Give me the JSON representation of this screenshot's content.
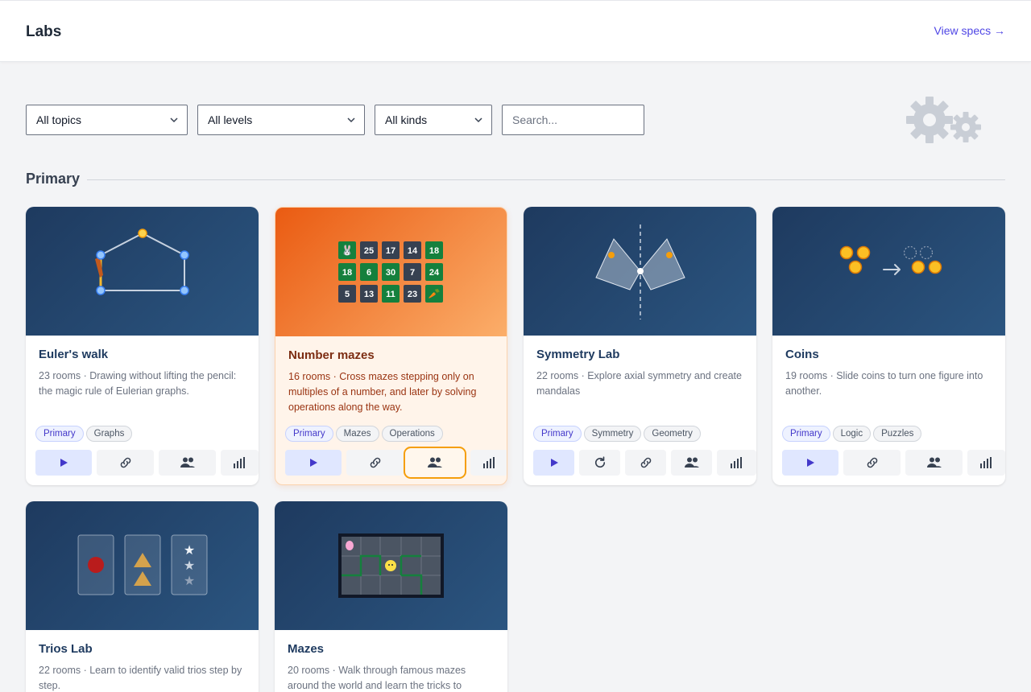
{
  "header": {
    "title": "Labs",
    "specs_link": "View specs →"
  },
  "filters": {
    "topic": "All topics",
    "level": "All levels",
    "kind": "All kinds",
    "search_placeholder": "Search..."
  },
  "section": {
    "title": "Primary"
  },
  "colors": {
    "accent": "#4f46e5",
    "card_thumb": "#1e3a5f",
    "active_card": "#ea5b12",
    "focus_ring": "#f59e0b"
  },
  "cards": [
    {
      "title": "Euler's walk",
      "desc": "23 rooms · Drawing without lifting the pencil: the magic rule of Eulerian graphs.",
      "tags": [
        "Primary",
        "Graphs"
      ],
      "icons": [
        "play-icon",
        "link-icon",
        "users-icon",
        "stats-icon"
      ]
    },
    {
      "title": "Number mazes",
      "desc": "16 rooms · Cross mazes stepping only on multiples of a number, and later by solving operations along the way.",
      "tags": [
        "Primary",
        "Mazes",
        "Operations"
      ],
      "grid": [
        [
          "🐰",
          "25",
          "17",
          "14",
          "18"
        ],
        [
          "18",
          "6",
          "30",
          "7",
          "24"
        ],
        [
          "5",
          "13",
          "11",
          "23",
          "🥕"
        ]
      ],
      "icons": [
        "play-icon",
        "link-icon",
        "users-icon",
        "stats-icon"
      ]
    },
    {
      "title": "Symmetry Lab",
      "desc": "22 rooms · Explore axial symmetry and create mandalas",
      "tags": [
        "Primary",
        "Symmetry",
        "Geometry"
      ],
      "icons": [
        "play-icon",
        "refresh-icon",
        "link-icon",
        "users-icon",
        "stats-icon"
      ]
    },
    {
      "title": "Coins",
      "desc": "19 rooms · Slide coins to turn one figure into another.",
      "tags": [
        "Primary",
        "Logic",
        "Puzzles"
      ],
      "icons": [
        "play-icon",
        "link-icon",
        "users-icon",
        "stats-icon"
      ]
    },
    {
      "title": "Trios Lab",
      "desc": "22 rooms · Learn to identify valid trios step by step.",
      "tags": [],
      "icons": []
    },
    {
      "title": "Mazes",
      "desc": "20 rooms · Walk through famous mazes around the world and learn the tricks to",
      "tags": [],
      "icons": []
    }
  ]
}
